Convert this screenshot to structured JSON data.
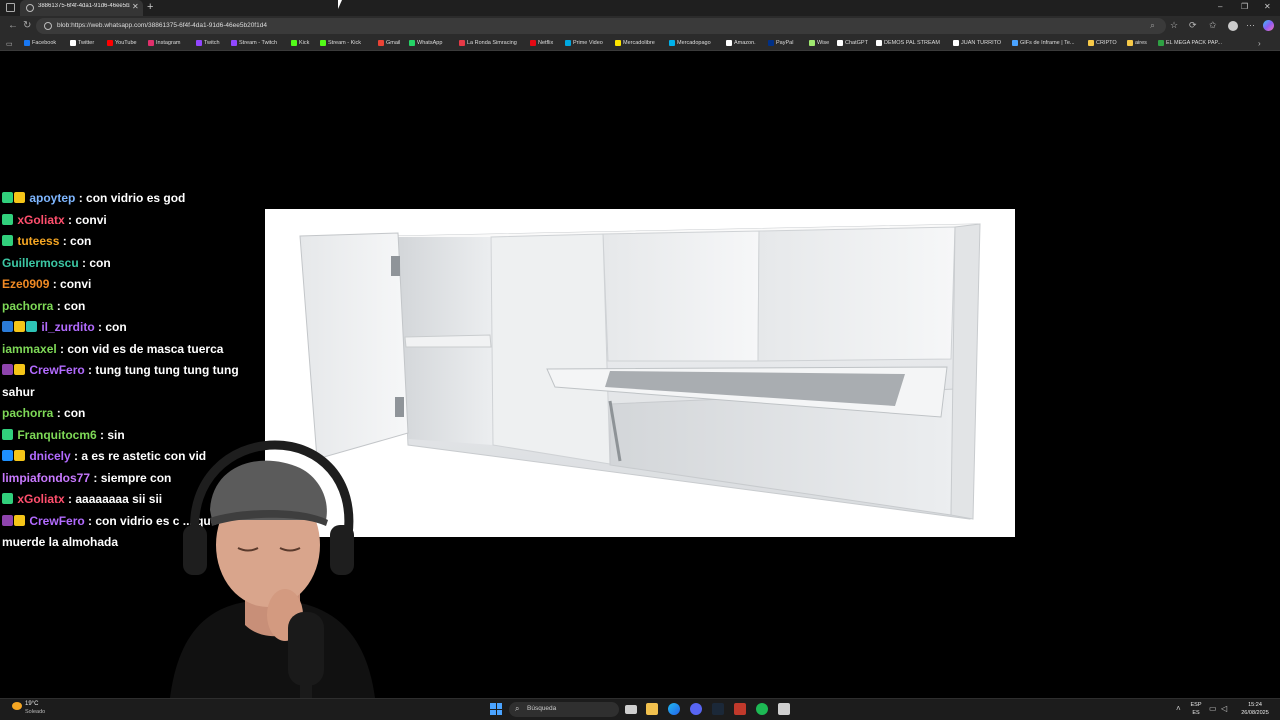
{
  "browser": {
    "tab": {
      "title": "38861375-6f4f-4da1-91d6-46ee5b20f1d4"
    },
    "address_bar": {
      "url": "blob:https://web.whatsapp.com/38861375-6f4f-4da1-91d6-46ee5b20f1d4"
    },
    "bookmarks": [
      {
        "label": "Facebook",
        "color": "#1877f2"
      },
      {
        "label": "Twitter",
        "color": "#ffffff"
      },
      {
        "label": "YouTube",
        "color": "#ff0000"
      },
      {
        "label": "Instagram",
        "color": "#e1306c"
      },
      {
        "label": "Twitch",
        "color": "#9146ff"
      },
      {
        "label": "Stream - Twitch",
        "color": "#9146ff"
      },
      {
        "label": "Kick",
        "color": "#53fc18"
      },
      {
        "label": "Stream - Kick",
        "color": "#53fc18"
      },
      {
        "label": "Gmail",
        "color": "#ea4335"
      },
      {
        "label": "WhatsApp",
        "color": "#25d366"
      },
      {
        "label": "La Ronda Simracing",
        "color": "#e63946"
      },
      {
        "label": "Netflix",
        "color": "#e50914"
      },
      {
        "label": "Prime Video",
        "color": "#00a8e1"
      },
      {
        "label": "Mercadolibre",
        "color": "#ffe600"
      },
      {
        "label": "Mercadopago",
        "color": "#00b1ea"
      },
      {
        "label": "Amazon.",
        "color": "#ffffff"
      },
      {
        "label": "PayPal",
        "color": "#003087"
      },
      {
        "label": "Wise",
        "color": "#9fe870"
      },
      {
        "label": "ChatGPT",
        "color": "#ffffff"
      },
      {
        "label": "DEMOS PAL STREAM",
        "color": "#ffffff"
      },
      {
        "label": "JUAN TURRITO",
        "color": "#ffffff"
      },
      {
        "label": "GIFs de Inframe | Te...",
        "color": "#4aa3ff"
      },
      {
        "label": "CRIPTO",
        "color": "#f7c948"
      },
      {
        "label": "aires",
        "color": "#f7c948"
      },
      {
        "label": "EL MEGA PACK PAP...",
        "color": "#2ea043"
      }
    ]
  },
  "chat": [
    {
      "badges": [
        "#31d07c",
        "#f5c518"
      ],
      "user": "apoytep",
      "user_color": "#7eb6ff",
      "msg": "con vidrio es god"
    },
    {
      "badges": [
        "#31d07c"
      ],
      "user": "xGoliatx",
      "user_color": "#ff4f6d",
      "msg": "convi"
    },
    {
      "badges": [
        "#31d07c"
      ],
      "user": "tuteess",
      "user_color": "#f5a623",
      "msg": "con"
    },
    {
      "badges": [],
      "user": "Guillermoscu",
      "user_color": "#3cc7a4",
      "msg": "con"
    },
    {
      "badges": [],
      "user": "Eze0909",
      "user_color": "#f08a24",
      "msg": "convi"
    },
    {
      "badges": [],
      "user": "pachorra",
      "user_color": "#7ed957",
      "msg": "con"
    },
    {
      "badges": [
        "#2b7bd8",
        "#f5c518",
        "#2ec4b6"
      ],
      "user": "il_zurdito",
      "user_color": "#b36bff",
      "msg": "con"
    },
    {
      "badges": [],
      "user": "iammaxel",
      "user_color": "#7ed957",
      "msg": "con vid es de masca tuerca"
    },
    {
      "badges": [
        "#8e44ad",
        "#f5c518"
      ],
      "user": "CrewFero",
      "user_color": "#b36bff",
      "msg": "tung tung tung tung tung sahur"
    },
    {
      "badges": [],
      "user": "pachorra",
      "user_color": "#7ed957",
      "msg": "con"
    },
    {
      "badges": [
        "#31d07c"
      ],
      "user": "Franquitocm6",
      "user_color": "#7ed957",
      "msg": "sin"
    },
    {
      "badges": [
        "#1e90ff",
        "#f5c518"
      ],
      "user": "dnicely",
      "user_color": "#b36bff",
      "msg": "a es re astetic con vid"
    },
    {
      "badges": [],
      "user": "limpiafondos77",
      "user_color": "#c879ff",
      "msg": "siempre con"
    },
    {
      "badges": [
        "#31d07c"
      ],
      "user": "xGoliatx",
      "user_color": "#ff4f6d",
      "msg": "aaaaaaaa sii sii"
    },
    {
      "badges": [
        "#8e44ad",
        "#f5c518"
      ],
      "user": "CrewFero",
      "user_color": "#b36bff",
      "msg": "con vidrio es c ... que muerde la almohada"
    }
  ],
  "taskbar": {
    "weather_temp": "19°C",
    "weather_cond": "Soleado",
    "search_label": "Búsqueda",
    "lang_top": "ESP",
    "lang_bottom": "ES",
    "time": "15:24",
    "date": "26/08/2025"
  }
}
